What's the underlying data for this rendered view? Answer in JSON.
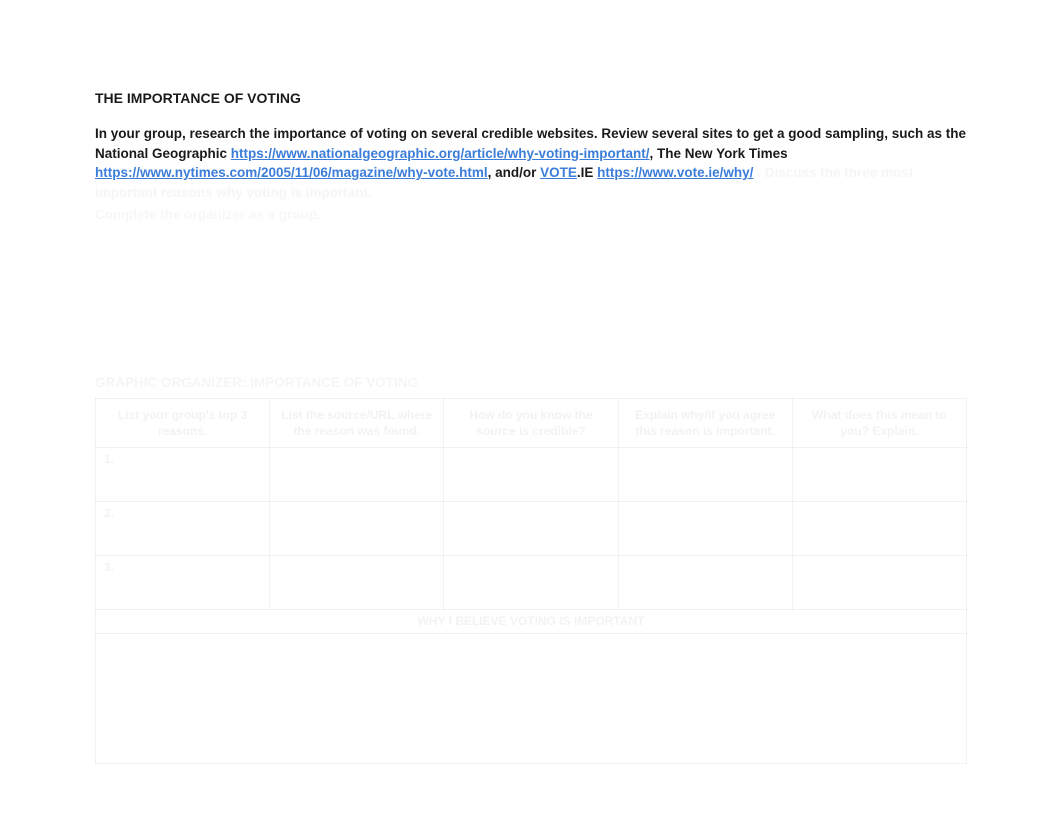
{
  "title": "THE IMPORTANCE OF VOTING",
  "intro": {
    "part1": "In your group, research the importance of voting on several credible websites. Review several sites to get a good sampling, such as the National Geographic ",
    "link1_text": "https://www.nationalgeographic.org/article/why-voting-important/",
    "link1_href": "https://www.nationalgeographic.org/article/why-voting-important/",
    "part2": ", The New York Times ",
    "link2_text": "https://www.nytimes.com/2005/11/06/magazine/why-vote.html",
    "link2_href": "https://www.nytimes.com/2005/11/06/magazine/why-vote.html",
    "part3": ", and/or ",
    "link3a_text": "VOTE",
    "link3a_href": "https://www.vote.ie/why/",
    "part3b": ".IE ",
    "link3b_text": "https://www.vote.ie/why/",
    "link3b_href": "https://www.vote.ie/why/",
    "faded_trail": "  . Discuss the three most important reasons why voting is important.",
    "faded_line2": "Complete the organizer as a group."
  },
  "table_section_title": "GRAPHIC ORGANIZER: IMPORTANCE OF VOTING",
  "table": {
    "headers": {
      "h1": "List your group's top 3 reasons.",
      "h2": "List the source/URL where the reason was found.",
      "h3": "How do you know the source is credible?",
      "h4": "Explain why/if you agree this reason is important.",
      "h5": "What does this mean to you? Explain.",
      "footer": "WHY I BELIEVE VOTING IS IMPORTANT"
    },
    "rows": {
      "r1": "1.",
      "r2": "2.",
      "r3": "3."
    }
  }
}
